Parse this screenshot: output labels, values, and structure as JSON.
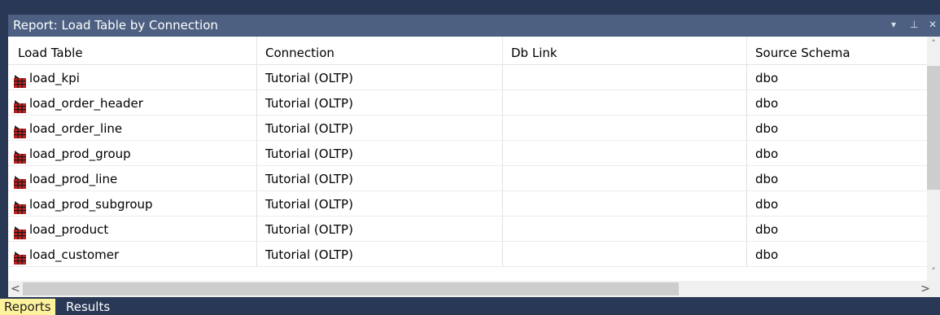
{
  "panel": {
    "title": "Report: Load Table by Connection",
    "controls": [
      "▾",
      "⊥",
      "✕"
    ]
  },
  "table": {
    "columns": [
      "Load Table",
      "Connection",
      "Db Link",
      "Source Schema"
    ],
    "rows": [
      {
        "load_table": "load_kpi",
        "connection": "Tutorial (OLTP)",
        "db_link": "",
        "source_schema": "dbo"
      },
      {
        "load_table": "load_order_header",
        "connection": "Tutorial (OLTP)",
        "db_link": "",
        "source_schema": "dbo"
      },
      {
        "load_table": "load_order_line",
        "connection": "Tutorial (OLTP)",
        "db_link": "",
        "source_schema": "dbo"
      },
      {
        "load_table": "load_prod_group",
        "connection": "Tutorial (OLTP)",
        "db_link": "",
        "source_schema": "dbo"
      },
      {
        "load_table": "load_prod_line",
        "connection": "Tutorial (OLTP)",
        "db_link": "",
        "source_schema": "dbo"
      },
      {
        "load_table": "load_prod_subgroup",
        "connection": "Tutorial (OLTP)",
        "db_link": "",
        "source_schema": "dbo"
      },
      {
        "load_table": "load_product",
        "connection": "Tutorial (OLTP)",
        "db_link": "",
        "source_schema": "dbo"
      },
      {
        "load_table": "load_customer",
        "connection": "Tutorial (OLTP)",
        "db_link": "",
        "source_schema": "dbo"
      }
    ],
    "row_icon": "load-table-icon"
  },
  "scroll": {
    "up": "˄",
    "down": "˅",
    "left": "<",
    "right": ">"
  },
  "tabs": [
    {
      "label": "Reports",
      "active": true
    },
    {
      "label": "Results",
      "active": false
    }
  ],
  "colors": {
    "background": "#293955",
    "titlebar": "#4D6082",
    "active_tab": "#FFF29D",
    "icon_red": "#C0201E"
  }
}
